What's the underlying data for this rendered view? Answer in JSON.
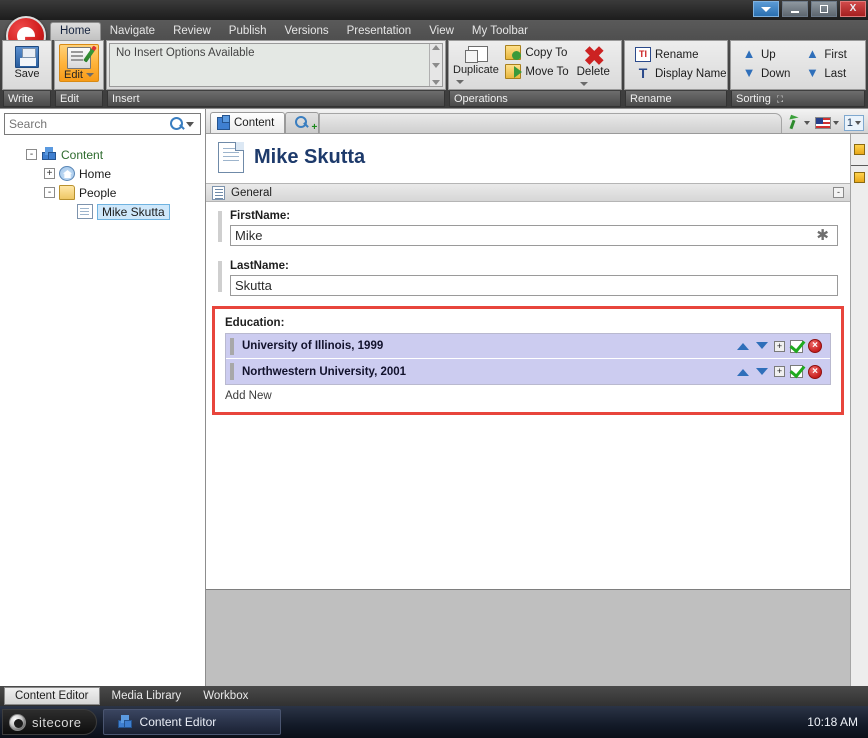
{
  "window": {
    "controls": [
      {
        "name": "dropdown",
        "label": ""
      },
      {
        "name": "minimize",
        "label": ""
      },
      {
        "name": "maximize",
        "label": ""
      },
      {
        "name": "close",
        "label": "X"
      }
    ]
  },
  "ribbon": {
    "tabs": [
      {
        "label": "Home",
        "active": true
      },
      {
        "label": "Navigate",
        "active": false
      },
      {
        "label": "Review",
        "active": false
      },
      {
        "label": "Publish",
        "active": false
      },
      {
        "label": "Versions",
        "active": false
      },
      {
        "label": "Presentation",
        "active": false
      },
      {
        "label": "View",
        "active": false
      },
      {
        "label": "My Toolbar",
        "active": false
      }
    ],
    "groups": {
      "write": {
        "label": "Write",
        "save_label": "Save"
      },
      "edit": {
        "label": "Edit",
        "edit_label": "Edit"
      },
      "insert": {
        "label": "Insert",
        "message": "No Insert Options Available"
      },
      "operations": {
        "label": "Operations",
        "duplicate_label": "Duplicate",
        "copy_to_label": "Copy To",
        "move_to_label": "Move To",
        "delete_label": "Delete"
      },
      "rename": {
        "label": "Rename",
        "rename_label": "Rename",
        "display_name_label": "Display Name"
      },
      "sorting": {
        "label": "Sorting",
        "up_label": "Up",
        "down_label": "Down",
        "first_label": "First",
        "last_label": "Last"
      }
    }
  },
  "sidebar": {
    "search": {
      "value": "",
      "placeholder": "Search"
    },
    "tree": [
      {
        "label": "Content",
        "icon": "content-cubes-icon",
        "expander": "-",
        "depth": 0,
        "selected": false
      },
      {
        "label": "Home",
        "icon": "home-icon",
        "expander": "+",
        "depth": 1,
        "selected": false
      },
      {
        "label": "People",
        "icon": "folder-icon",
        "expander": "-",
        "depth": 1,
        "selected": false
      },
      {
        "label": "Mike Skutta",
        "icon": "document-icon",
        "expander": "",
        "depth": 2,
        "selected": true
      }
    ]
  },
  "content": {
    "tabs": [
      {
        "label": "Content",
        "icon": "content-shield-icon",
        "active": true
      },
      {
        "label": "",
        "icon": "search-add-icon",
        "active": false
      }
    ],
    "toolbar": {
      "cursor_icon": "green-cursor-icon",
      "language_icon": "us-flag-icon",
      "version": "1"
    },
    "title": "Mike Skutta",
    "section": {
      "label": "General",
      "collapse_glyph": "-"
    },
    "fields": [
      {
        "label": "FirstName:",
        "value": "Mike",
        "required": true,
        "required_glyph": "✱"
      },
      {
        "label": "LastName:",
        "value": "Skutta",
        "required": false,
        "required_glyph": ""
      }
    ],
    "education": {
      "label": "Education:",
      "highlight_color": "#e8453c",
      "items": [
        {
          "name": "University of Illinois, 1999"
        },
        {
          "name": "Northwestern University, 2001"
        }
      ],
      "actions": [
        {
          "name": "move-up-icon",
          "glyph": ""
        },
        {
          "name": "move-down-icon",
          "glyph": ""
        },
        {
          "name": "expand-icon",
          "glyph": "+"
        },
        {
          "name": "edit-check-icon",
          "glyph": ""
        },
        {
          "name": "remove-icon",
          "glyph": "×"
        }
      ],
      "add_new_label": "Add New"
    }
  },
  "bottom_tabs": [
    {
      "label": "Content Editor",
      "active": true
    },
    {
      "label": "Media Library",
      "active": false
    },
    {
      "label": "Workbox",
      "active": false
    }
  ],
  "taskbar": {
    "start_label": "sitecore",
    "task_label": "Content Editor",
    "clock": "10:18 AM"
  }
}
